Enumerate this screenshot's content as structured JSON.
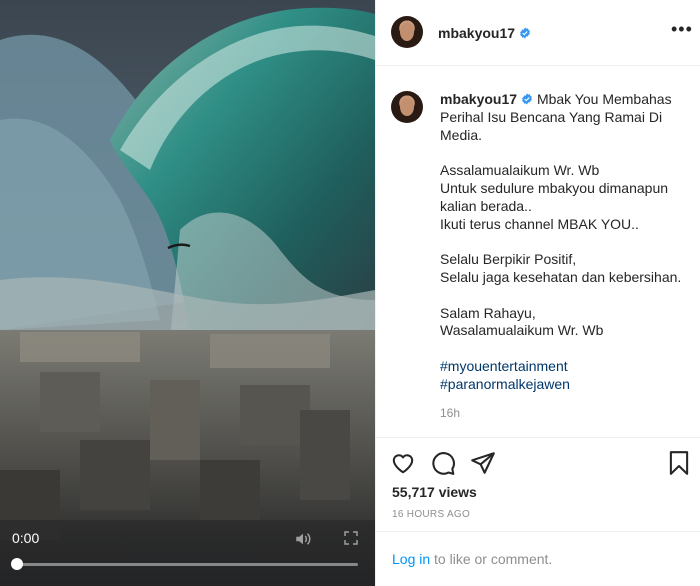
{
  "post": {
    "username": "mbakyou17",
    "caption_headline": "Mbak You Membahas Perihal Isu Bencana Yang Ramai Di Media.",
    "caption_body": "Assalamualaikum Wr. Wb\nUntuk sedulure mbakyou dimanapun kalian berada..\nIkuti terus channel MBAK YOU..\n\nSelalu Berpikir Positif,\nSelalu jaga kesehatan dan kebersihan.\n\nSalam Rahayu,\nWasalamualaikum Wr. Wb",
    "hashtags": [
      "#myouentertainment",
      "#paranormalkejawen"
    ],
    "caption_time": "16h",
    "views": "55,717 views",
    "posted_ago": "16 HOURS AGO"
  },
  "video": {
    "current_time": "0:00",
    "progress": 0
  },
  "comment_bar": {
    "login_link": "Log in",
    "login_suffix": " to like or comment."
  },
  "icons": {
    "verified": "verified-badge-icon",
    "more": "more-options-icon",
    "like": "heart-icon",
    "comment": "comment-bubble-icon",
    "share": "paper-plane-icon",
    "save": "bookmark-icon",
    "mute": "speaker-icon",
    "fullscreen": "fullscreen-icon"
  },
  "colors": {
    "verified": "#3897f0",
    "link": "#0095f6",
    "hashtag": "#00376b",
    "muted_text": "#8e8e8e"
  }
}
